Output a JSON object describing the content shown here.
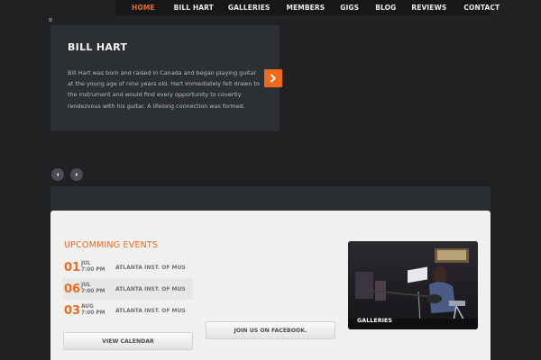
{
  "nav": {
    "items": [
      {
        "label": "HOME",
        "active": true
      },
      {
        "label": "BILL HART",
        "active": false
      },
      {
        "label": "GALLERIES",
        "active": false
      },
      {
        "label": "MEMBERS",
        "active": false
      },
      {
        "label": "GIGS",
        "active": false
      },
      {
        "label": "BLOG",
        "active": false
      },
      {
        "label": "REVIEWS",
        "active": false
      },
      {
        "label": "CONTACT",
        "active": false
      }
    ]
  },
  "slider": {
    "title": "BILL HART",
    "text": "Bill Hart was born and raised in Canada and began playing guitar at the young age of nine years old. Hart immediately felt drawn to the instrument and would find every opportunity to covertly rendezvous with his guitar. A lifelong connection was formed.",
    "next_icon": "chevron-right-icon",
    "prev_ctrl_icon": "chevron-left-icon",
    "next_ctrl_icon": "chevron-right-icon"
  },
  "events": {
    "heading": "UPCOMMING EVENTS",
    "items": [
      {
        "day": "01",
        "month": "JUL",
        "time": "7:00 PM",
        "place": "ATLANTA INST. OF MUS"
      },
      {
        "day": "06",
        "month": "JUL",
        "time": "7:00 PM",
        "place": "ATLANTA INST. OF MUS"
      },
      {
        "day": "03",
        "month": "AUG",
        "time": "7:00 PM",
        "place": "ATLANTA INST. OF MUS"
      }
    ],
    "view_calendar": "VIEW CALENDAR"
  },
  "facebook": {
    "label": "JOIN US ON FACEBOOK."
  },
  "gallery": {
    "label": "GALLERIES"
  },
  "colors": {
    "accent": "#f06a1c",
    "background": "#1f2123",
    "panel": "#2d3033",
    "light_panel": "#f0f0f0"
  }
}
